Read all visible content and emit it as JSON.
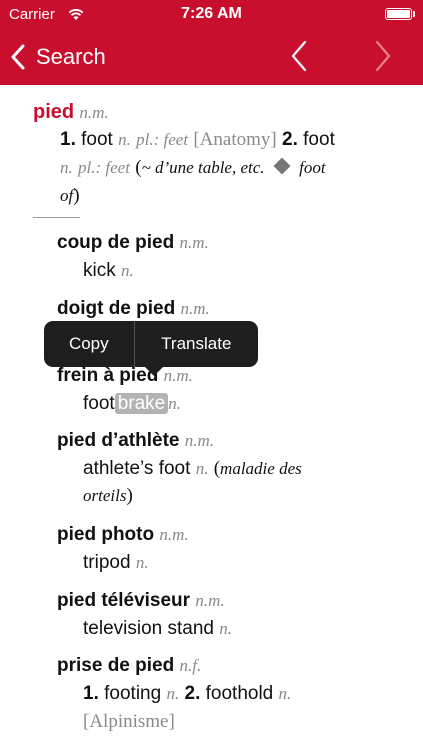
{
  "status_bar": {
    "carrier": "Carrier",
    "time": "7:26 AM"
  },
  "nav": {
    "back_label": "Search"
  },
  "entry": {
    "headword": "pied",
    "pos": "n.m.",
    "sense1_num": "1.",
    "sense1_word": "foot",
    "sense1_pos": "n.",
    "sense1_plural": "pl.: feet",
    "sense1_domain": "[Anatomy]",
    "sense2_num": "2.",
    "sense2_word": "foot",
    "sense2_pos": "n.",
    "sense2_plural": "pl.: feet",
    "sense2_paren_open": "(",
    "sense2_note": "~ d’une table, etc.",
    "sense2_ex": "foot",
    "sense2_ex2": "of",
    "sense2_paren_close": ")"
  },
  "subentries": {
    "coup": {
      "hw": "coup de pied",
      "pos": "n.m.",
      "tr": "kick",
      "tr_pos": "n."
    },
    "doigt": {
      "hw": "doigt de pied",
      "pos": "n.m."
    },
    "frein": {
      "hw": "frein à pied",
      "pos": "n.m.",
      "tr_a": "foot",
      "tr_b": "brake",
      "tr_pos": "n."
    },
    "athlete": {
      "hw": "pied d’athlète",
      "pos": "n.m.",
      "tr": "athlete’s foot",
      "tr_pos": "n.",
      "note_open": "(",
      "note1": "maladie des",
      "note2": "orteils",
      "note_close": ")"
    },
    "photo": {
      "hw": "pied photo",
      "pos": "n.m.",
      "tr": "tripod",
      "tr_pos": "n."
    },
    "televiseur": {
      "hw": "pied téléviseur",
      "pos": "n.m.",
      "tr": "television stand",
      "tr_pos": "n."
    },
    "prise": {
      "hw": "prise de pied",
      "pos": "n.f.",
      "s1_num": "1.",
      "s1": "footing",
      "s1_pos": "n.",
      "s2_num": "2.",
      "s2": "foothold",
      "s2_pos": "n.",
      "domain": "[Alpinisme]"
    }
  },
  "context_menu": {
    "copy": "Copy",
    "translate": "Translate"
  }
}
